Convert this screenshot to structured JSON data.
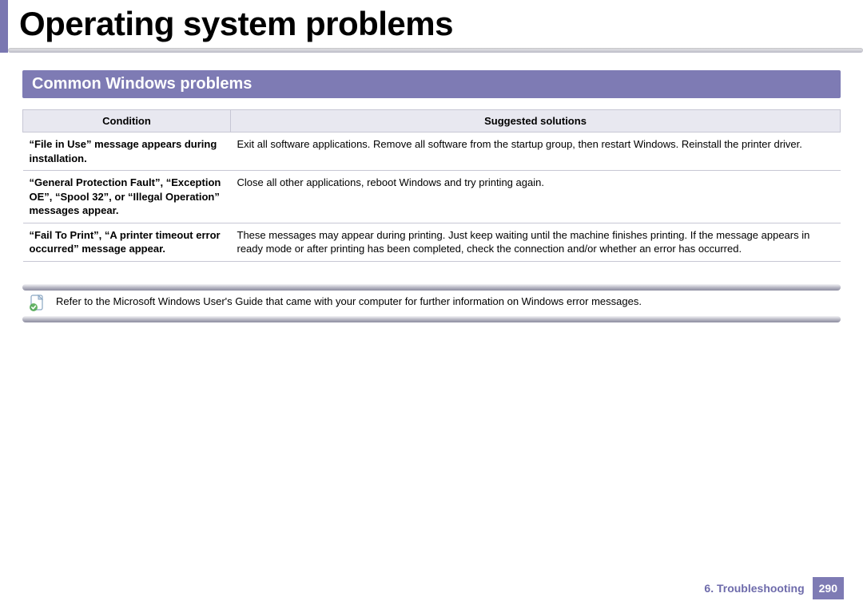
{
  "page": {
    "title": "Operating system problems",
    "section": "Common Windows problems"
  },
  "table": {
    "headers": {
      "condition": "Condition",
      "solutions": "Suggested solutions"
    },
    "rows": [
      {
        "condition": "“File in Use” message appears during installation.",
        "solution": "Exit all software applications. Remove all software from the startup group, then restart Windows. Reinstall the printer driver."
      },
      {
        "condition": "“General Protection Fault”, “Exception OE”, “Spool 32”, or “Illegal Operation” messages appear.",
        "solution": "Close all other applications, reboot Windows and try printing again."
      },
      {
        "condition": "“Fail To Print”, “A printer timeout error occurred” message appear.",
        "solution": "These messages may appear during printing. Just keep waiting until the machine finishes printing. If the message appears in ready mode or after printing has been completed, check the connection and/or whether an error has occurred."
      }
    ]
  },
  "note": {
    "text": "Refer to the Microsoft Windows User's Guide that came with your computer for further information on Windows error messages."
  },
  "footer": {
    "chapter": "6.  Troubleshooting",
    "page": "290"
  },
  "icons": {
    "note": "note-page-icon"
  }
}
